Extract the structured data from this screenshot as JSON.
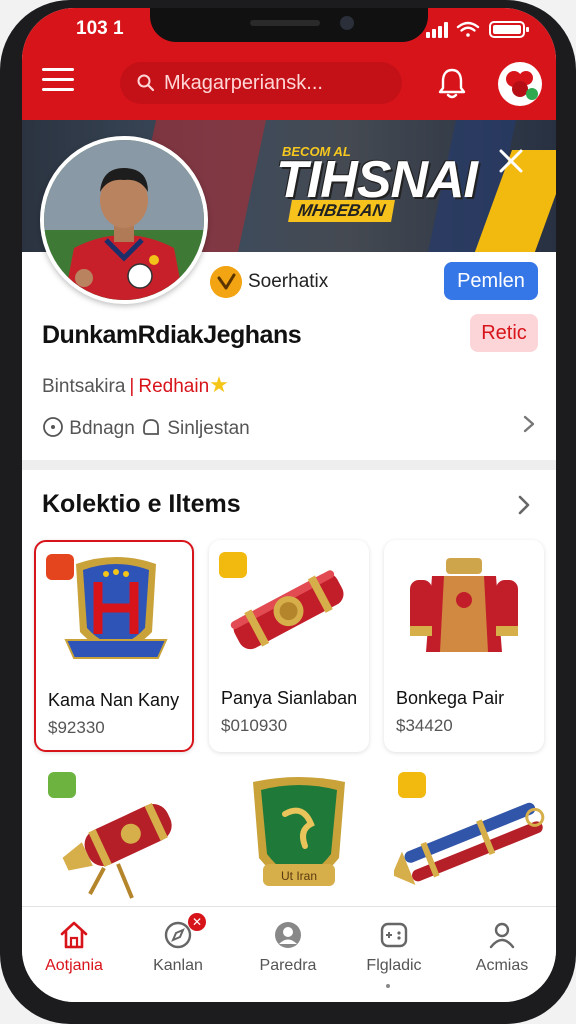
{
  "status": {
    "time": "103 1"
  },
  "header": {
    "search_text": "Mkagarperiansk..."
  },
  "banner": {
    "subtitle": "BECOM AL",
    "title": "TIHSNAI",
    "tag": "MHBEBAN"
  },
  "profile": {
    "verified_label": "Soerhatix",
    "follow_label": "Pemlen",
    "name": "DunkamRdiakJeghans",
    "rank_label": "Retic",
    "meta_prefix": "Bintsakira",
    "meta_highlight": "Redhain",
    "info_left": "Bdnagn",
    "info_right": "Sinljestan"
  },
  "collection": {
    "title": "Kolektio e Iltems",
    "items": [
      {
        "name": "Kama Nan Kany",
        "price": "$92330"
      },
      {
        "name": "Panya Sianlaban",
        "price": "$010930"
      },
      {
        "name": "Bonkega Pair",
        "price": "$34420"
      }
    ],
    "row2_badge": "Ut Iran"
  },
  "nav": {
    "items": [
      {
        "label": "Aotjania"
      },
      {
        "label": "Kanlan"
      },
      {
        "label": "Paredra"
      },
      {
        "label": "Flgladic"
      },
      {
        "label": "Acmias"
      }
    ]
  },
  "colors": {
    "brand": "#d8141b",
    "accent": "#3577e6"
  }
}
